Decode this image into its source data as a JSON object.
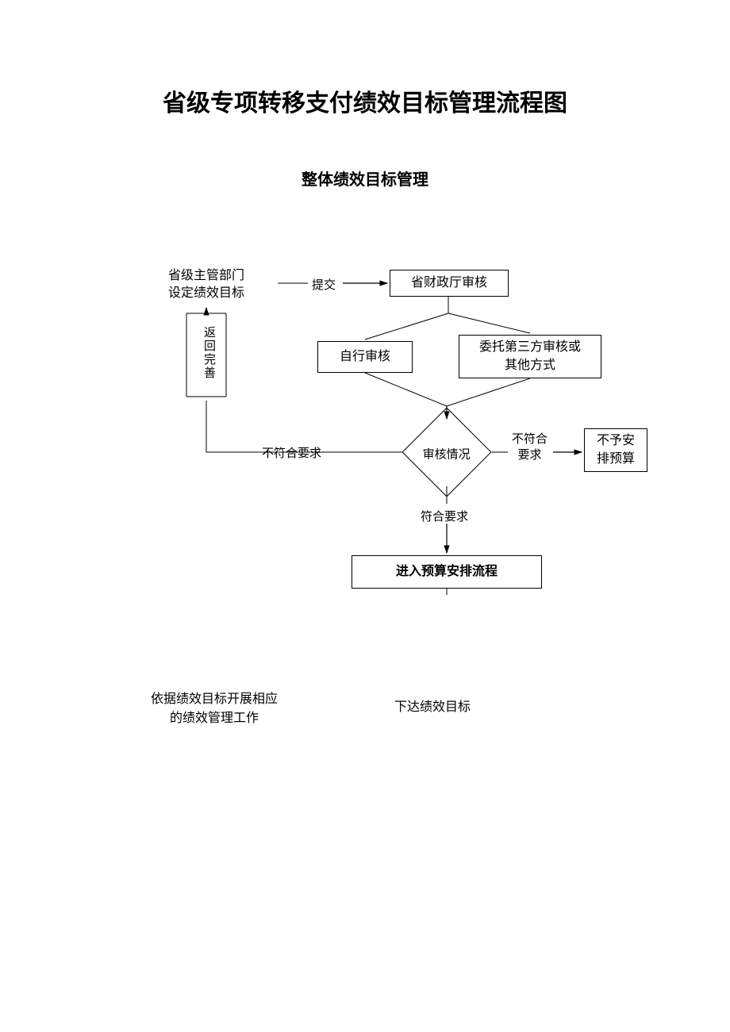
{
  "title": "省级专项转移支付绩效目标管理流程图",
  "subtitle": "整体绩效目标管理",
  "nodes": {
    "start": "省级主管部门\n设定绩效目标",
    "submit": "提交",
    "review": "省财政厅审核",
    "self_review": "自行审核",
    "third_party": "委托第三方审核或\n其他方式",
    "return_improve": "返回完善",
    "not_meet_left": "不符合要求",
    "decision": "审核情况",
    "not_meet_right": "不符合\n要求",
    "no_budget": "不予安\n排预算",
    "meet": "符合要求",
    "enter_budget": "进入预算安排流程"
  },
  "bottom": {
    "left": "依据绩效目标开展相应\n的绩效管理工作",
    "right": "下达绩效目标"
  }
}
